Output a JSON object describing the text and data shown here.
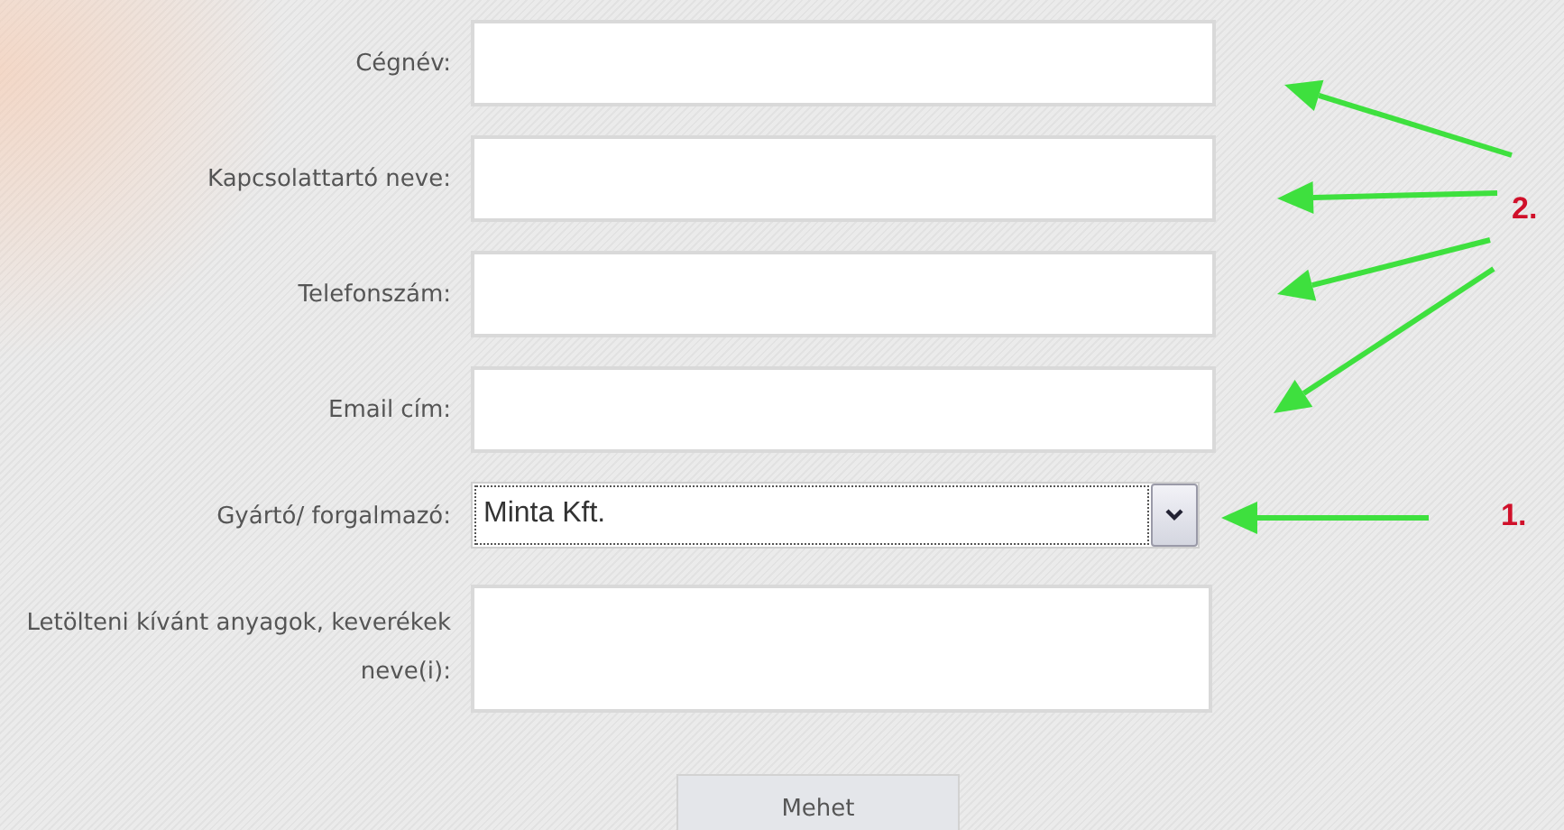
{
  "form": {
    "fields": [
      {
        "kind": "text",
        "label": "Cégnév:"
      },
      {
        "kind": "text",
        "label": "Kapcsolattartó neve:"
      },
      {
        "kind": "text",
        "label": "Telefonszám:"
      },
      {
        "kind": "text",
        "label": "Email cím:"
      },
      {
        "kind": "select",
        "label": "Gyártó/ forgalmazó:",
        "value": "Minta Kft."
      },
      {
        "kind": "textarea",
        "label": "Letölteni kívánt anyagok, keverékek neve(i):"
      }
    ],
    "submit": "Mehet"
  },
  "annotations": [
    {
      "number": "2."
    },
    {
      "number": "1."
    }
  ]
}
